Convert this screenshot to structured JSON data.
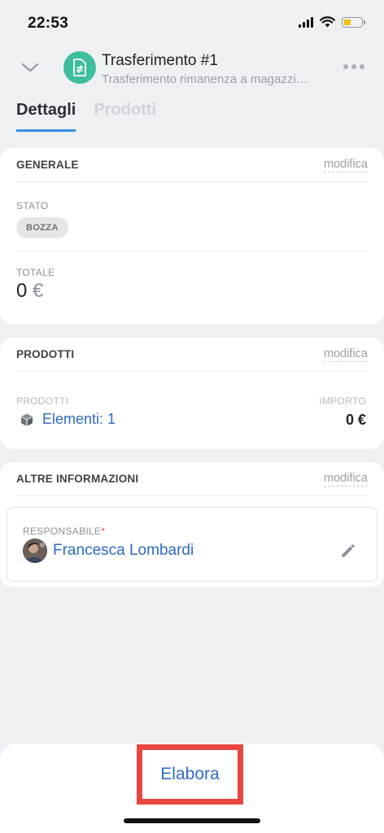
{
  "status_bar": {
    "time": "22:53"
  },
  "header": {
    "title": "Trasferimento #1",
    "subtitle": "Trasferimento rimanenza a magazzino",
    "tabs": [
      {
        "label": "Dettagli",
        "active": true
      },
      {
        "label": "Prodotti",
        "active": false
      }
    ]
  },
  "general": {
    "title": "GENERALE",
    "edit": "modifica",
    "status_label": "STATO",
    "status_value": "BOZZA",
    "total_label": "TOTALE",
    "total_value": "0",
    "currency": "€"
  },
  "products": {
    "title": "PRODOTTI",
    "edit": "modifica",
    "col_products": "PRODOTTI",
    "col_amount": "IMPORTO",
    "elements": "Elementi: 1",
    "amount": "0 €"
  },
  "other_info": {
    "title": "ALTRE INFORMAZIONI",
    "edit": "modifica",
    "responsible_label": "RESPONSABILE",
    "required_mark": "*",
    "responsible_name": "Francesca Lombardi"
  },
  "footer": {
    "process_button": "Elabora"
  },
  "colors": {
    "accent": "#2f6ac2",
    "tab_underline": "#3a8ee6",
    "doc_icon_bg": "#3dbf9d",
    "highlight": "#e8463f"
  },
  "icons": [
    "chevron-down-icon",
    "document-transfer-icon",
    "more-icon",
    "box-icon",
    "pencil-icon"
  ]
}
